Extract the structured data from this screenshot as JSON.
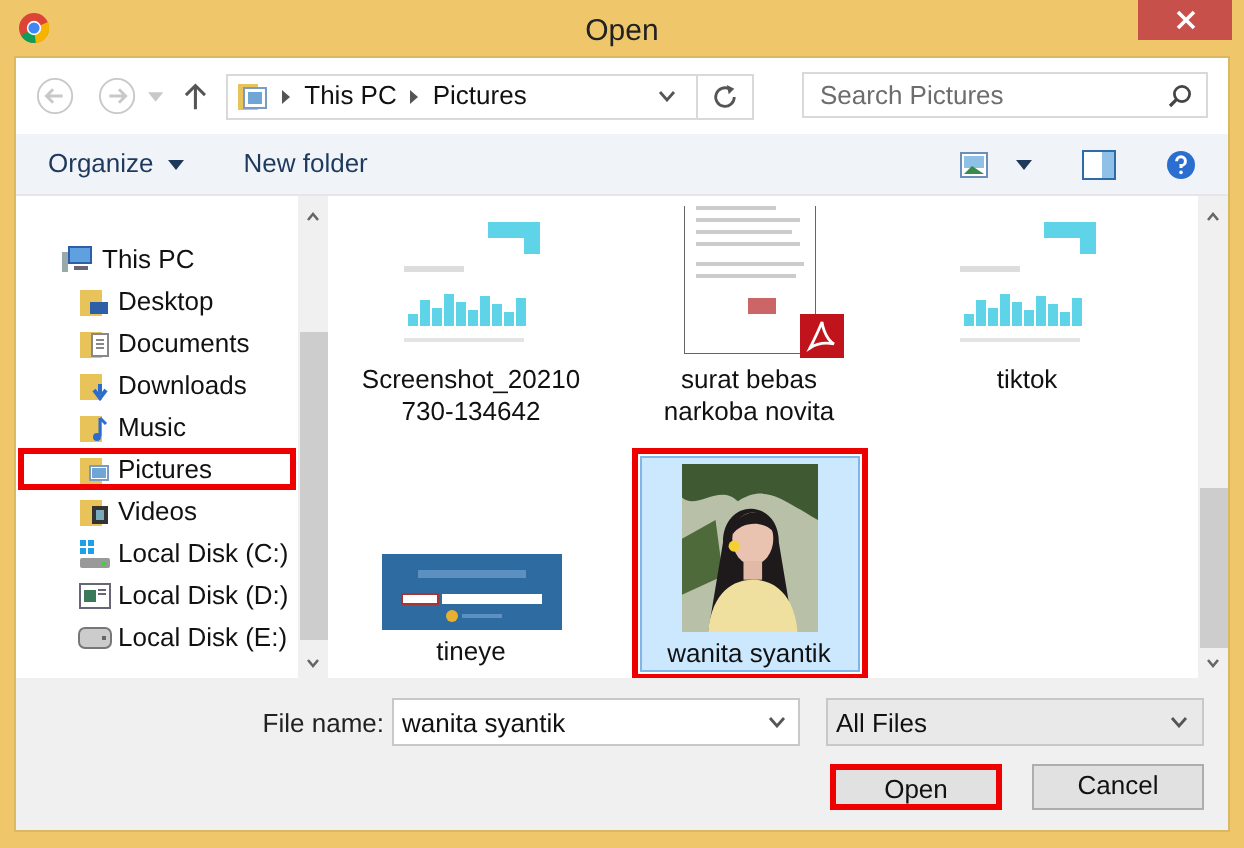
{
  "window": {
    "title": "Open"
  },
  "address": {
    "path": [
      "This PC",
      "Pictures"
    ]
  },
  "search": {
    "placeholder": "Search Pictures"
  },
  "toolbar": {
    "organize": "Organize",
    "new_folder": "New folder"
  },
  "nav": [
    {
      "label": "This PC",
      "highlighted": false,
      "children": [
        {
          "label": "Desktop",
          "highlighted": false
        },
        {
          "label": "Documents",
          "highlighted": false
        },
        {
          "label": "Downloads",
          "highlighted": false
        },
        {
          "label": "Music",
          "highlighted": false
        },
        {
          "label": "Pictures",
          "highlighted": true
        },
        {
          "label": "Videos",
          "highlighted": false
        },
        {
          "label": "Local Disk (C:)",
          "highlighted": false
        },
        {
          "label": "Local Disk (D:)",
          "highlighted": false
        },
        {
          "label": "Local Disk (E:)",
          "highlighted": false
        }
      ]
    }
  ],
  "files": [
    {
      "name": "Screenshot_20210 730-134642",
      "kind": "screenshot",
      "selected": false,
      "highlighted": false
    },
    {
      "name": "surat bebas narkoba novita",
      "kind": "pdf",
      "selected": false,
      "highlighted": false
    },
    {
      "name": "tiktok",
      "kind": "screenshot",
      "selected": false,
      "highlighted": false
    },
    {
      "name": "tineye",
      "kind": "banner",
      "selected": false,
      "highlighted": false
    },
    {
      "name": "wanita syantik",
      "selected": true,
      "highlighted": true
    }
  ],
  "file_name": {
    "label": "File name:",
    "value": "wanita syantik"
  },
  "file_type": {
    "value": "All Files"
  },
  "buttons": [
    {
      "label": "Open",
      "highlighted": true
    },
    {
      "label": "Cancel",
      "highlighted": false
    }
  ]
}
